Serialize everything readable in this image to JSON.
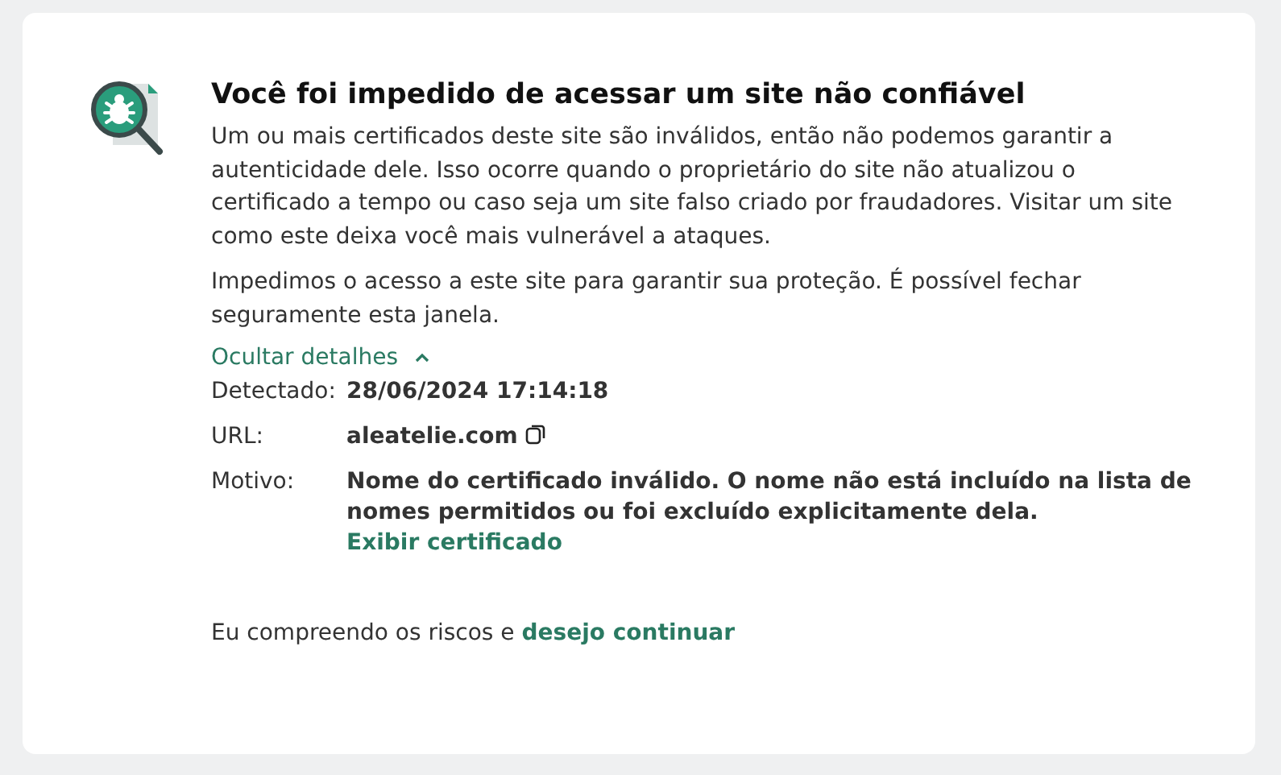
{
  "title": "Você foi impedido de acessar um site não confiável",
  "paragraphs": [
    "Um ou mais certificados deste site são inválidos, então não podemos garantir a autenticidade dele. Isso ocorre quando o proprietário do site não atualizou o certificado a tempo ou caso seja um site falso criado por fraudadores. Visitar um site como este deixa você mais vulnerável a ataques.",
    "Impedimos o acesso a este site para garantir sua proteção. É possível fechar seguramente esta janela."
  ],
  "details_toggle": {
    "label": "Ocultar detalhes",
    "expanded": true
  },
  "details": [
    {
      "kind": "text",
      "label": "Detectado:",
      "value": "28/06/2024 17:14:18"
    },
    {
      "kind": "copy",
      "label": "URL:",
      "value": "aleatelie.com"
    },
    {
      "kind": "link",
      "label": "Motivo:",
      "value": "Nome do certificado inválido. O nome não está incluído na lista de nomes permitidos ou foi excluído explicitamente dela.",
      "link": "Exibir certificado"
    }
  ],
  "footer": {
    "text": "Eu compreendo os riscos e",
    "link": "desejo continuar"
  }
}
